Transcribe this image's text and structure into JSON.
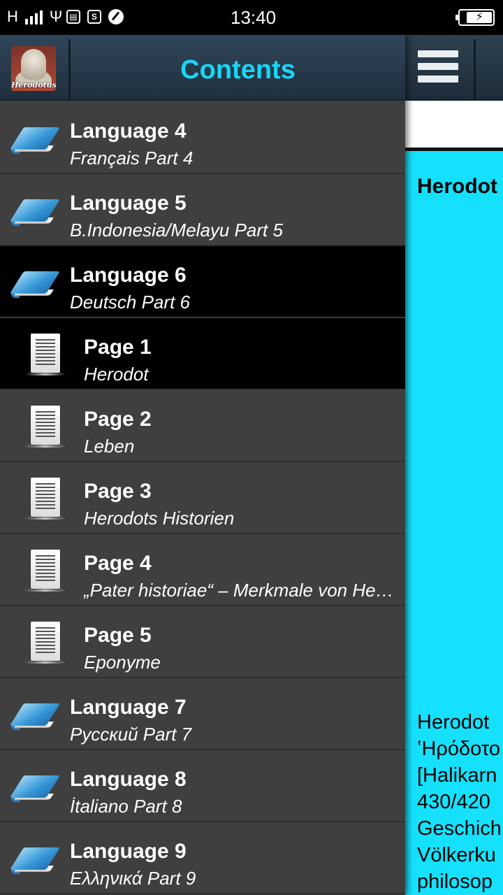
{
  "status_bar": {
    "network": "H",
    "time": "13:40",
    "icons": [
      "signal-icon",
      "usb-icon",
      "file-icon",
      "s-icon",
      "circle-icon",
      "battery-icon"
    ]
  },
  "drawer": {
    "logo_text": "Herodotus",
    "title": "Contents",
    "items": [
      {
        "icon": "book-icon",
        "title": "Language 4",
        "subtitle": "Français Part 4",
        "active": false,
        "kind": "language"
      },
      {
        "icon": "book-icon",
        "title": "Language 5",
        "subtitle": "B.Indonesia/Melayu Part 5",
        "active": false,
        "kind": "language"
      },
      {
        "icon": "book-icon",
        "title": "Language 6",
        "subtitle": "Deutsch Part 6",
        "active": true,
        "kind": "language"
      },
      {
        "icon": "page-icon",
        "title": "Page 1",
        "subtitle": "Herodot",
        "active": true,
        "kind": "page"
      },
      {
        "icon": "page-icon",
        "title": "Page 2",
        "subtitle": "Leben",
        "active": false,
        "kind": "page"
      },
      {
        "icon": "page-icon",
        "title": "Page 3",
        "subtitle": "Herodots Historien",
        "active": false,
        "kind": "page"
      },
      {
        "icon": "page-icon",
        "title": "Page 4",
        "subtitle": "„Pater historiae“ – Merkmale von He…",
        "active": false,
        "kind": "page"
      },
      {
        "icon": "page-icon",
        "title": "Page 5",
        "subtitle": "Eponyme",
        "active": false,
        "kind": "page"
      },
      {
        "icon": "book-icon",
        "title": "Language 7",
        "subtitle": "Русский Part 7",
        "active": false,
        "kind": "language"
      },
      {
        "icon": "book-icon",
        "title": "Language 8",
        "subtitle": "İtaliano Part 8",
        "active": false,
        "kind": "language"
      },
      {
        "icon": "book-icon",
        "title": "Language 9",
        "subtitle": "Ελληνικά Part 9",
        "active": false,
        "kind": "language"
      }
    ]
  },
  "main": {
    "heading": "Herodot",
    "body_lines": [
      "Herodot",
      "ʽΗρόδοτο",
      "[Halikarn",
      "430/420",
      "Geschich",
      "Völkerku",
      "philosop"
    ],
    "background": "#15e1fd"
  }
}
